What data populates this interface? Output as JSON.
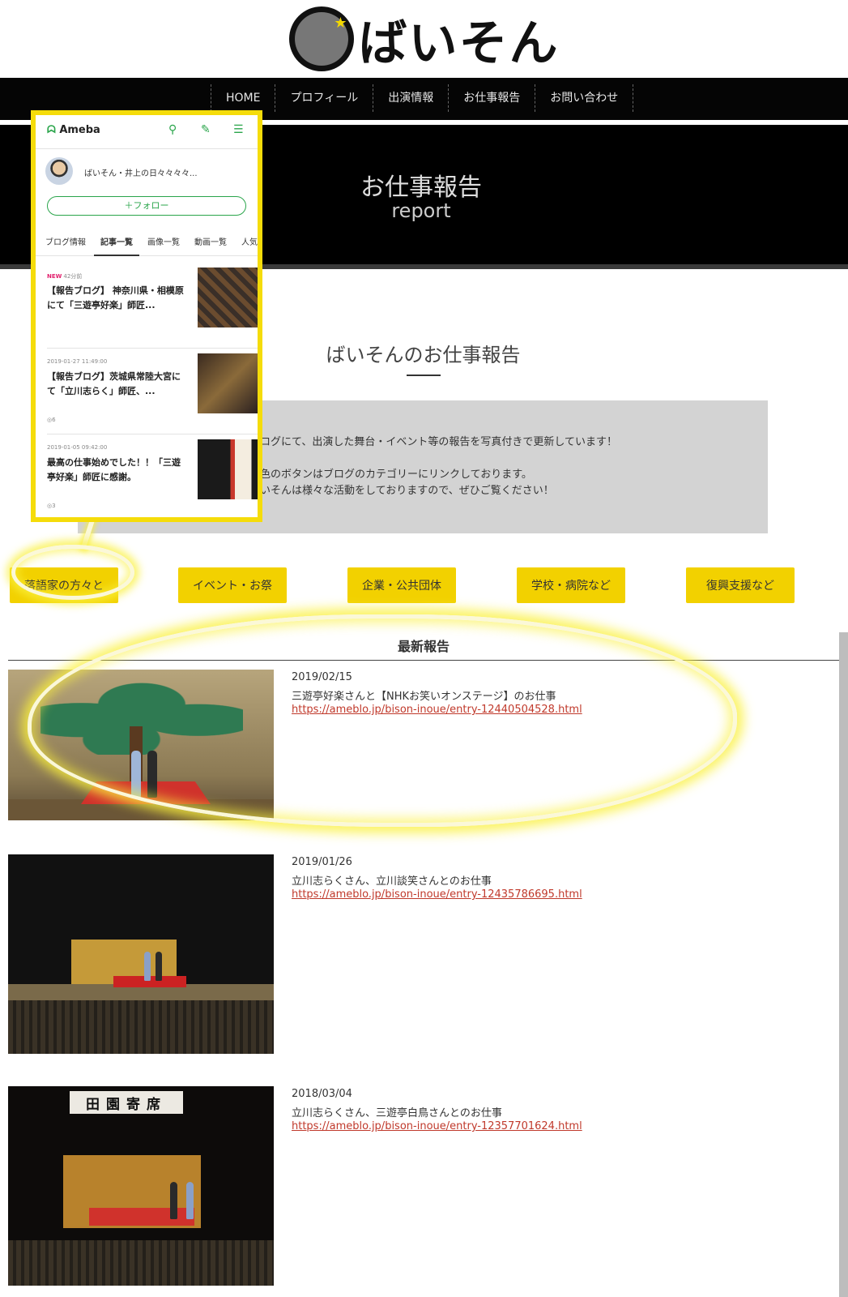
{
  "logo": {
    "text": "ばいそん"
  },
  "nav": [
    "HOME",
    "プロフィール",
    "出演情報",
    "お仕事報告",
    "お問い合わせ"
  ],
  "hero": {
    "title": "お仕事報告",
    "subtitle": "report"
  },
  "section": {
    "title": "ばいそんのお仕事報告"
  },
  "info": {
    "line1": "ブログにて、出演した舞台・イベント等の報告を写真付きで更新しています！",
    "line2": "黄色のボタンはブログのカテゴリーにリンクしております。",
    "line3": "ばいそんは様々な活動をしておりますので、ぜひご覧ください！"
  },
  "categories": [
    "落語家の方々と",
    "イベント・お祭",
    "企業・公共団体",
    "学校・病院など",
    "復興支援など"
  ],
  "latest": {
    "heading": "最新報告"
  },
  "reports": [
    {
      "date": "2019/02/15",
      "title": "三遊亭好楽さんと【NHKお笑いオンステージ】のお仕事",
      "url": "https://ameblo.jp/bison-inoue/entry-12440504528.html"
    },
    {
      "date": "2019/01/26",
      "title": "立川志らくさん、立川談笑さんとのお仕事",
      "url": "https://ameblo.jp/bison-inoue/entry-12435786695.html"
    },
    {
      "date": "2018/03/04",
      "title": "立川志らくさん、三遊亭白鳥さんとのお仕事",
      "url": "https://ameblo.jp/bison-inoue/entry-12357701624.html"
    }
  ],
  "thumb3_banner": "田園寄席",
  "ameba": {
    "logo": "Ameba",
    "profile_name": "ばいそん・井上の日々々々々...",
    "follow_label": "＋フォロー",
    "tabs": [
      "ブログ情報",
      "記事一覧",
      "画像一覧",
      "動画一覧",
      "人気"
    ],
    "active_tab": "記事一覧",
    "posts": [
      {
        "badge": "NEW",
        "meta": "42分前",
        "title": "【報告ブログ】 神奈川県・相模原にて「三遊亭好楽」師匠...",
        "count": ""
      },
      {
        "badge": "",
        "meta": "2019-01-27 11:49:00",
        "title": "【報告ブログ】茨城県常陸大宮にて「立川志らく」師匠、...",
        "count": "6"
      },
      {
        "badge": "",
        "meta": "2019-01-05 09:42:00",
        "title": "最高の仕事始めでした！！「三遊亭好楽」師匠に感謝。",
        "count": "3"
      }
    ]
  },
  "colors": {
    "accent_yellow": "#f2d100",
    "nav_bg": "#050505",
    "link_red": "#c0392b",
    "ameba_green": "#2aa54b"
  },
  "icons": [
    "search-icon",
    "edit-icon",
    "menu-icon"
  ]
}
